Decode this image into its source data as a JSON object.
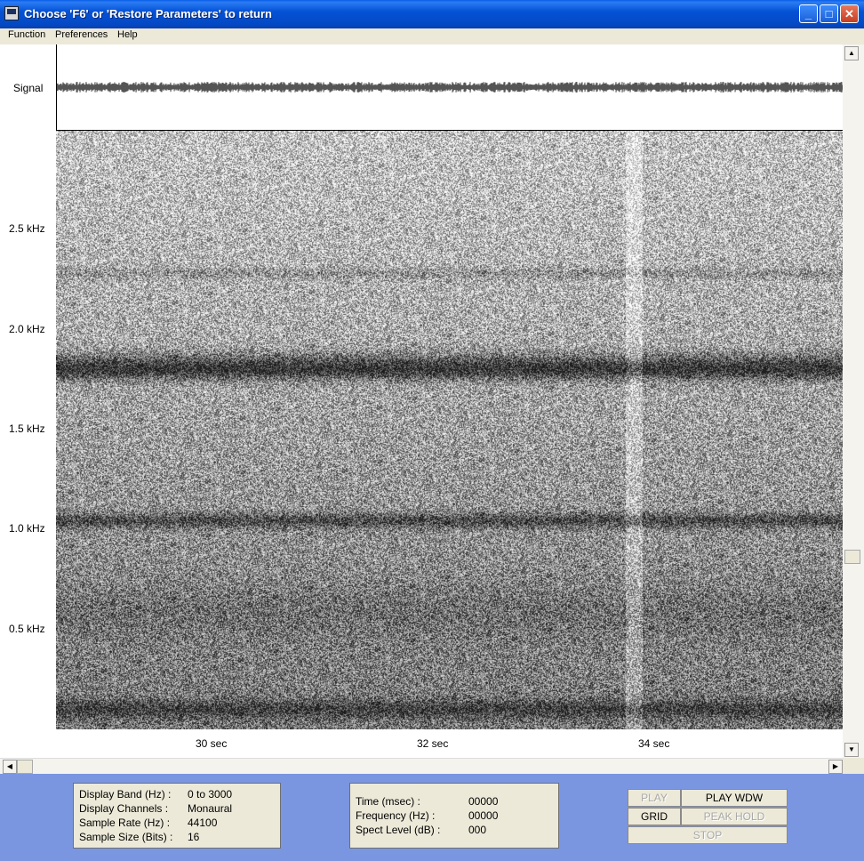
{
  "window": {
    "title": "Choose 'F6' or 'Restore Parameters' to return"
  },
  "menu": [
    "Function",
    "Preferences",
    "Help"
  ],
  "plot": {
    "signal_label": "Signal",
    "y_labels": [
      "2.5 kHz",
      "2.0 kHz",
      "1.5 kHz",
      "1.0 kHz",
      "0.5 kHz"
    ],
    "x_labels": [
      "30  sec",
      "32  sec",
      "34  sec"
    ]
  },
  "info": {
    "display_band_label": "Display Band (Hz) :",
    "display_band_value": "0 to 3000",
    "display_channels_label": "Display Channels :",
    "display_channels_value": "Monaural",
    "sample_rate_label": "Sample Rate (Hz) :",
    "sample_rate_value": "44100",
    "sample_size_label": "Sample Size (Bits) :",
    "sample_size_value": "16"
  },
  "readout": {
    "time_label": "Time (msec) :",
    "time_value": "00000",
    "frequency_label": "Frequency (Hz) :",
    "frequency_value": "00000",
    "spect_level_label": "Spect Level (dB) :",
    "spect_level_value": "000"
  },
  "buttons": {
    "play": "PLAY",
    "play_wdw": "PLAY WDW",
    "grid": "GRID",
    "peak_hold": "PEAK HOLD",
    "stop": "STOP"
  }
}
